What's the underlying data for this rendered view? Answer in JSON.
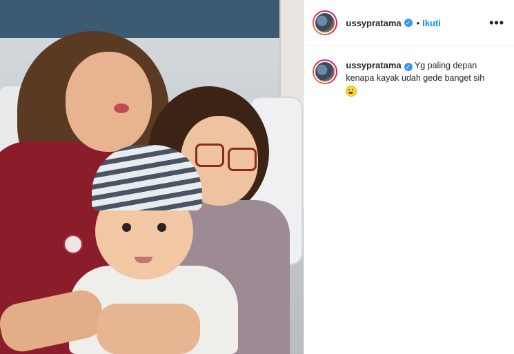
{
  "post": {
    "username": "ussypratama",
    "verified_glyph": "✓",
    "separator": "•",
    "follow_label": "Ikuti",
    "more_glyph": "•••",
    "caption": {
      "line1": "Yg paling depan",
      "line2": "kenapa kayak udah gede banget sih"
    },
    "emoji_name": "grinning-sweat-emoji"
  },
  "colors": {
    "accent": "#0095f6",
    "verified": "#3897f0",
    "text": "#262626"
  }
}
